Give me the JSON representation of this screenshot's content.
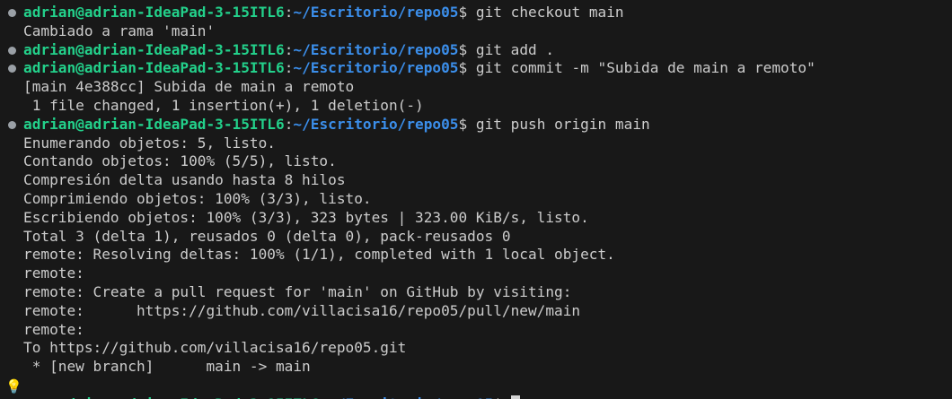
{
  "theme": {
    "background": "#181818",
    "foreground": "#cccccc",
    "prompt_user_color": "#23d18b",
    "prompt_path_color": "#3b8eea",
    "decoration_dot_color": "#9aa0a6",
    "lightbulb_color": "#f2c94c"
  },
  "prompt": {
    "user_host": "adrian@adrian-IdeaPad-3-15ITL6",
    "path": "~/Escritorio/repo05",
    "symbol": "$"
  },
  "lines": [
    {
      "prompt": true,
      "command": "git checkout main"
    },
    {
      "prompt": false,
      "text": "Cambiado a rama 'main'"
    },
    {
      "prompt": true,
      "command": "git add ."
    },
    {
      "prompt": true,
      "command": "git commit -m \"Subida de main a remoto\""
    },
    {
      "prompt": false,
      "text": "[main 4e388cc] Subida de main a remoto"
    },
    {
      "prompt": false,
      "text": " 1 file changed, 1 insertion(+), 1 deletion(-)"
    },
    {
      "prompt": true,
      "command": "git push origin main"
    },
    {
      "prompt": false,
      "text": "Enumerando objetos: 5, listo."
    },
    {
      "prompt": false,
      "text": "Contando objetos: 100% (5/5), listo."
    },
    {
      "prompt": false,
      "text": "Compresión delta usando hasta 8 hilos"
    },
    {
      "prompt": false,
      "text": "Comprimiendo objetos: 100% (3/3), listo."
    },
    {
      "prompt": false,
      "text": "Escribiendo objetos: 100% (3/3), 323 bytes | 323.00 KiB/s, listo."
    },
    {
      "prompt": false,
      "text": "Total 3 (delta 1), reusados 0 (delta 0), pack-reusados 0"
    },
    {
      "prompt": false,
      "text": "remote: Resolving deltas: 100% (1/1), completed with 1 local object."
    },
    {
      "prompt": false,
      "text": "remote:"
    },
    {
      "prompt": false,
      "text": "remote: Create a pull request for 'main' on GitHub by visiting:"
    },
    {
      "prompt": false,
      "text": "remote:      https://github.com/villacisa16/repo05/pull/new/main"
    },
    {
      "prompt": false,
      "text": "remote:"
    },
    {
      "prompt": false,
      "text": "To https://github.com/villacisa16/repo05.git"
    },
    {
      "prompt": false,
      "text": " * [new branch]      main -> main"
    }
  ],
  "active_prompt": {
    "command": ""
  }
}
